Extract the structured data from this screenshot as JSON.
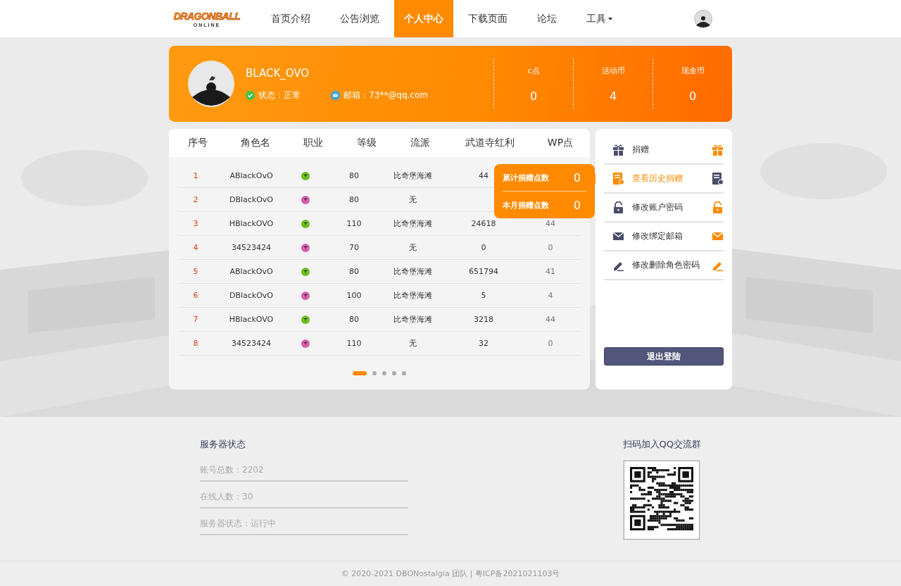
{
  "logo": {
    "title": "DRAGONBALL",
    "subtitle": "ONLINE"
  },
  "nav": [
    {
      "label": "首页介绍",
      "selected": false,
      "dropdown": false
    },
    {
      "label": "公告浏览",
      "selected": false,
      "dropdown": false
    },
    {
      "label": "个人中心",
      "selected": true,
      "dropdown": false
    },
    {
      "label": "下载页面",
      "selected": false,
      "dropdown": false
    },
    {
      "label": "论坛",
      "selected": false,
      "dropdown": false
    },
    {
      "label": "工具",
      "selected": false,
      "dropdown": true
    }
  ],
  "profile": {
    "username": "BLACK_OVO",
    "status": "状态：正常",
    "email": "邮箱：73**@qq.com",
    "stats": [
      {
        "label": "c点",
        "value": "0"
      },
      {
        "label": "活动币",
        "value": "4"
      },
      {
        "label": "现金币",
        "value": "0"
      }
    ]
  },
  "table": {
    "columns": [
      "序号",
      "角色名",
      "职业",
      "等级",
      "流派",
      "武道寺红利",
      "WP点"
    ],
    "rows": [
      {
        "index": "1",
        "name": "ABlackOvO",
        "color": "#6cbf1f",
        "level": "80",
        "school": "比奇堡海滩",
        "bonus": "44"
      },
      {
        "index": "2",
        "name": "DBlackOvO",
        "color": "#d85fae",
        "level": "80",
        "school": "无"
      },
      {
        "index": "3",
        "name": "HBlackOVO",
        "color": "#6cbf1f",
        "level": "110",
        "school": "比奇堡海滩",
        "bonus": "24618",
        "wp": "44"
      },
      {
        "index": "4",
        "name": "34523424",
        "color": "#d85fae",
        "level": "70",
        "school": "无",
        "bonus": "0",
        "wp": "0"
      },
      {
        "index": "5",
        "name": "ABlackOvO",
        "color": "#6cbf1f",
        "level": "80",
        "school": "比奇堡海滩",
        "bonus": "651794",
        "wp": "41"
      },
      {
        "index": "6",
        "name": "DBlackOvO",
        "color": "#d85fae",
        "level": "100",
        "school": "比奇堡海滩",
        "bonus": "5",
        "wp": "4"
      },
      {
        "index": "7",
        "name": "HBlackOVO",
        "color": "#6cbf1f",
        "level": "80",
        "school": "比奇堡海滩",
        "bonus": "3218",
        "wp": "44"
      },
      {
        "index": "8",
        "name": "34523424",
        "color": "#d85fae",
        "level": "110",
        "school": "无",
        "bonus": "32",
        "wp": "0"
      }
    ],
    "pages": [
      {
        "selected": true
      },
      {
        "selected": false
      },
      {
        "selected": false
      },
      {
        "selected": false
      },
      {
        "selected": false
      }
    ]
  },
  "donation_popup": [
    {
      "label": "累计捐赠点数",
      "value": "0"
    },
    {
      "label": "本月捐赠点数",
      "value": "0"
    }
  ],
  "menu": {
    "items": [
      {
        "label": "捐赠",
        "selected": false
      },
      {
        "label": "查看历史捐赠",
        "selected": true
      },
      {
        "label": "修改账户密码",
        "selected": false
      },
      {
        "label": "修改绑定邮箱",
        "selected": false
      },
      {
        "label": "修改删除角色密码",
        "selected": false
      }
    ],
    "logout": "退出登陆"
  },
  "footer": {
    "server_title": "服务器状态",
    "server_lines": [
      "账号总数：2202",
      "在线人数：30",
      "服务器状态：运行中"
    ],
    "qr_title": "扫码加入QQ交流群",
    "copyright": "© 2020-2021 DBONostalgia 团队 | 粤ICP备2021021103号"
  }
}
